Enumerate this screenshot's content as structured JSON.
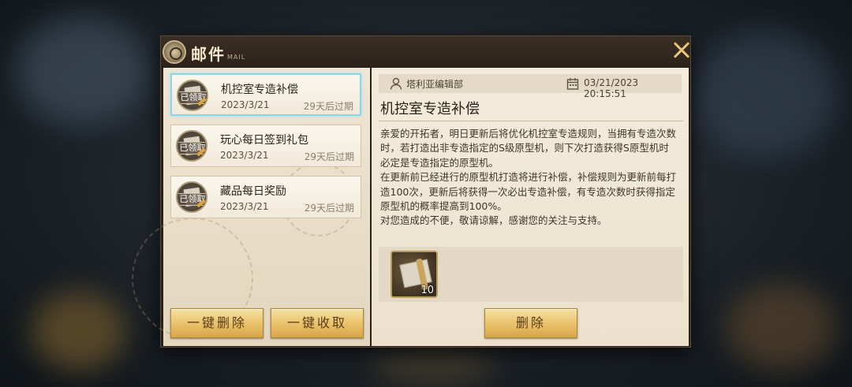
{
  "window": {
    "title": "邮件",
    "subtitle": "MAIL"
  },
  "mail_list": [
    {
      "status": "已领取",
      "title": "机控室专造补偿",
      "date": "2023/3/21",
      "expire": "29天后过期",
      "selected": true
    },
    {
      "status": "已领取",
      "title": "玩心每日签到礼包",
      "date": "2023/3/21",
      "expire": "29天后过期",
      "selected": false
    },
    {
      "status": "已领取",
      "title": "藏品每日奖励",
      "date": "2023/3/21",
      "expire": "29天后过期",
      "selected": false
    }
  ],
  "left_actions": {
    "delete_all": "一键删除",
    "claim_all": "一键收取"
  },
  "detail": {
    "sender": "塔利亚编辑部",
    "datetime": "03/21/2023 20:15:51",
    "title": "机控室专造补偿",
    "body": "亲爱的开拓者，明日更新后将优化机控室专造规则，当拥有专造次数时，若打造出非专造指定的S级原型机，则下次打造获得S原型机时必定是专造指定的原型机。\n在更新前已经进行的原型机打造将进行补偿，补偿规则为更新前每打造100次，更新后将获得一次必出专造补偿，有专造次数时获得指定原型机的概率提高到100%。\n对您造成的不便，敬请谅解，感谢您的关注与支持。",
    "attachments": [
      {
        "icon": "blueprint-scroll-icon",
        "count": "10"
      }
    ],
    "delete_label": "删除"
  },
  "icons": {
    "title": "mail-emblem-icon",
    "close": "close-icon",
    "sender": "user-icon",
    "date": "calendar-icon"
  },
  "colors": {
    "gold_button": "#e8c069",
    "selected_border": "#8fd3e6",
    "close_x": "#e7c47a"
  }
}
